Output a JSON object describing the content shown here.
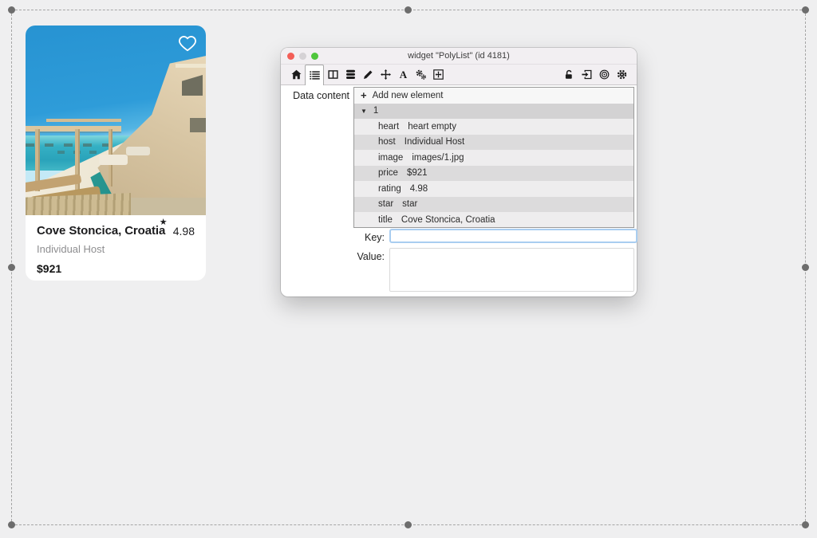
{
  "card": {
    "title": "Cove Stoncica, Croatia",
    "rating": "4.98",
    "star_icon": "★",
    "host": "Individual Host",
    "price": "$921"
  },
  "dialog": {
    "title": "widget \"PolyList\" (id 4181)",
    "data_content_label": "Data content",
    "list": {
      "add_icon": "+",
      "add_label": "Add new element",
      "collapse_icon": "▼",
      "group_label": "1",
      "rows": [
        {
          "key": "heart",
          "value": "heart empty"
        },
        {
          "key": "host",
          "value": "Individual Host"
        },
        {
          "key": "image",
          "value": "images/1.jpg"
        },
        {
          "key": "price",
          "value": "$921"
        },
        {
          "key": "rating",
          "value": "4.98"
        },
        {
          "key": "star",
          "value": "star"
        },
        {
          "key": "title",
          "value": "Cove Stoncica, Croatia"
        }
      ]
    },
    "key_label": "Key:",
    "key_value": "",
    "value_label": "Value:",
    "toolbar_icons": [
      "home",
      "list",
      "columns",
      "database",
      "pencil",
      "move",
      "font",
      "cogs",
      "frame-arrows"
    ],
    "toolbar_right_icons": [
      "unlock",
      "import",
      "target",
      "gear"
    ],
    "colors": {
      "close_button": "#f35e57",
      "minimize_button": "#d5d2d5",
      "zoom_button": "#4fc63c",
      "focus_ring": "#a9cdf0"
    }
  }
}
